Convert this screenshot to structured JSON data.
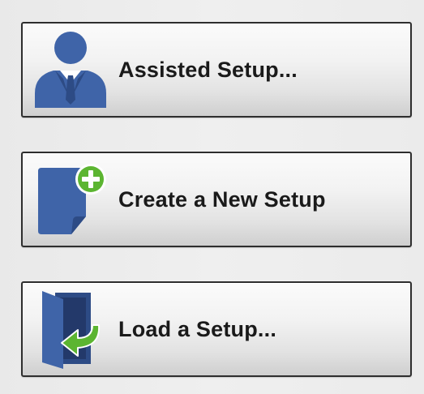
{
  "buttons": [
    {
      "label": "Assisted Setup...",
      "icon": "user-icon"
    },
    {
      "label": "Create a New Setup",
      "icon": "new-document-icon"
    },
    {
      "label": "Load a Setup...",
      "icon": "open-door-icon"
    }
  ],
  "colors": {
    "icon_blue": "#3f64a8",
    "icon_blue_dark": "#2d4b85",
    "accent_green": "#5cb531",
    "button_border": "#2e2e2e",
    "label_text": "#1a1a1a"
  }
}
